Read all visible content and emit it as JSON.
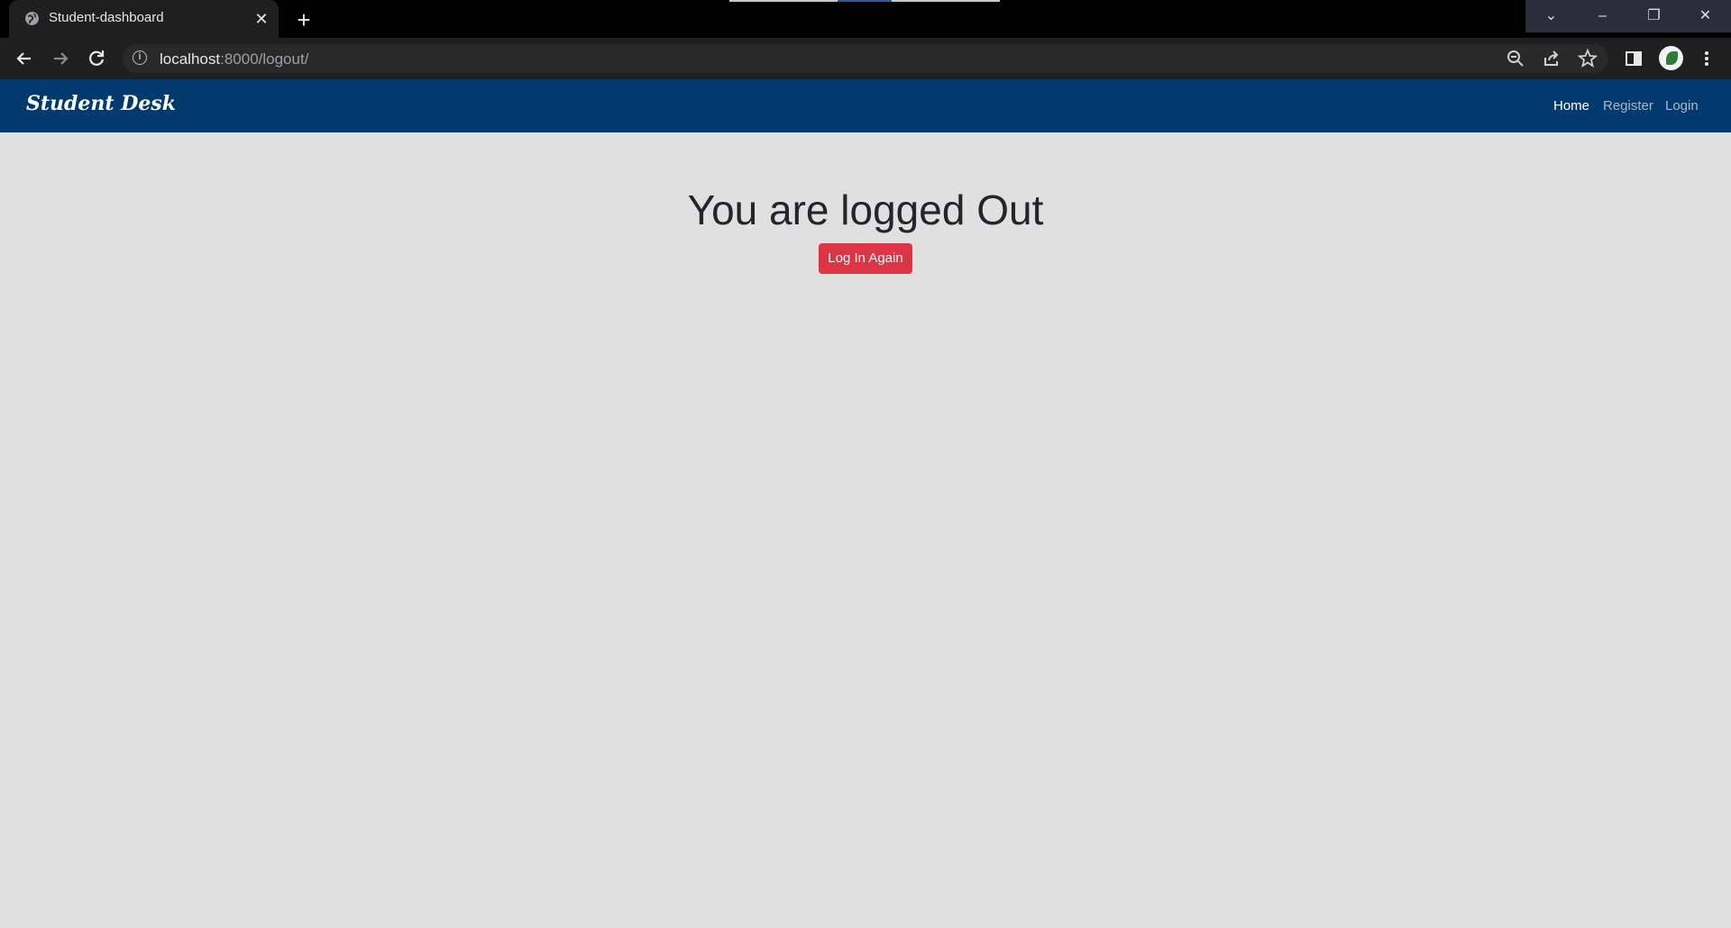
{
  "browser": {
    "tab_title": "Student-dashboard",
    "tab_close": "✕",
    "new_tab": "+",
    "url_host": "localhost",
    "url_path": ":8000/logout/",
    "icons": {
      "favicon": "globe-icon",
      "back": "arrow-left-icon",
      "forward": "arrow-right-icon",
      "reload": "reload-icon",
      "zoom": "zoom-out-icon",
      "share": "share-icon",
      "bookmark": "star-icon",
      "sidepanel": "side-panel-icon",
      "menu": "kebab-menu-icon"
    },
    "window": {
      "dropdown": "⌄",
      "minimize": "–",
      "maximize": "❐",
      "close": "✕"
    }
  },
  "site": {
    "brand": "Student Desk",
    "nav": [
      {
        "label": "Home",
        "active": true
      },
      {
        "label": "Register",
        "active": false
      },
      {
        "label": "Login",
        "active": false
      }
    ]
  },
  "main": {
    "heading": "You are logged Out",
    "button_label": "Log In Again"
  },
  "colors": {
    "navbar": "#033a6e",
    "button": "#dc3545",
    "page_bg": "#e0e0e0"
  }
}
